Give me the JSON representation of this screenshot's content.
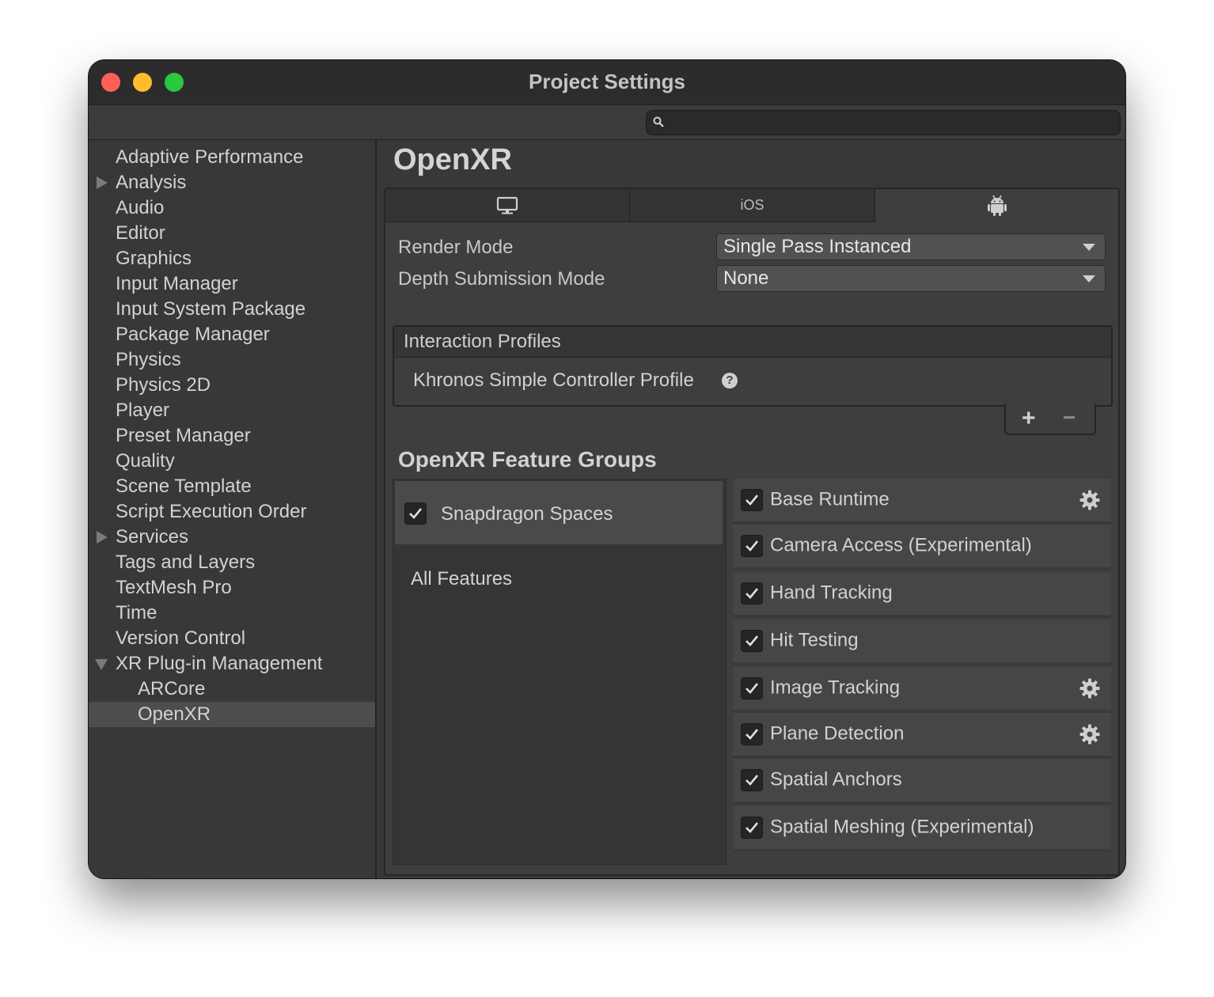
{
  "window": {
    "title": "Project Settings",
    "search": {
      "value": "",
      "placeholder": ""
    }
  },
  "sidebar": {
    "items": [
      {
        "label": "Adaptive Performance"
      },
      {
        "label": "Analysis",
        "expander": "collapsed"
      },
      {
        "label": "Audio"
      },
      {
        "label": "Editor"
      },
      {
        "label": "Graphics"
      },
      {
        "label": "Input Manager"
      },
      {
        "label": "Input System Package"
      },
      {
        "label": "Package Manager"
      },
      {
        "label": "Physics"
      },
      {
        "label": "Physics 2D"
      },
      {
        "label": "Player"
      },
      {
        "label": "Preset Manager"
      },
      {
        "label": "Quality"
      },
      {
        "label": "Scene Template"
      },
      {
        "label": "Script Execution Order"
      },
      {
        "label": "Services",
        "expander": "collapsed"
      },
      {
        "label": "Tags and Layers"
      },
      {
        "label": "TextMesh Pro"
      },
      {
        "label": "Time"
      },
      {
        "label": "Version Control"
      },
      {
        "label": "XR Plug-in Management",
        "expander": "expanded"
      },
      {
        "label": "ARCore",
        "child": true
      },
      {
        "label": "OpenXR",
        "child": true,
        "selected": true
      }
    ]
  },
  "main": {
    "heading": "OpenXR",
    "tabs": [
      {
        "icon": "desktop-icon",
        "label": ""
      },
      {
        "icon": "",
        "label": "iOS"
      },
      {
        "icon": "android-icon",
        "label": "",
        "active": true
      }
    ],
    "render_mode": {
      "label": "Render Mode",
      "value": "Single Pass Instanced"
    },
    "depth_mode": {
      "label": "Depth Submission Mode",
      "value": "None"
    },
    "interaction_profiles": {
      "header": "Interaction Profiles",
      "items": [
        "Khronos Simple Controller Profile"
      ],
      "help_glyph": "?",
      "add_glyph": "+",
      "remove_glyph": "−"
    },
    "feature_groups": {
      "title": "OpenXR Feature Groups",
      "groups": [
        {
          "label": "Snapdragon Spaces",
          "checked": true,
          "selected": true
        },
        {
          "label": "All Features"
        }
      ],
      "features": [
        {
          "label": "Base Runtime",
          "checked": true,
          "settings": true
        },
        {
          "label": "Camera Access (Experimental)",
          "checked": true,
          "settings": false
        },
        {
          "label": "Hand Tracking",
          "checked": true,
          "settings": false
        },
        {
          "label": "Hit Testing",
          "checked": true,
          "settings": false
        },
        {
          "label": "Image Tracking",
          "checked": true,
          "settings": true
        },
        {
          "label": "Plane Detection",
          "checked": true,
          "settings": true
        },
        {
          "label": "Spatial Anchors",
          "checked": true,
          "settings": false
        },
        {
          "label": "Spatial Meshing (Experimental)",
          "checked": true,
          "settings": false
        }
      ]
    }
  },
  "colors": {
    "background": "#383838",
    "titlebar": "#2c2c2c",
    "text": "#d2d2d2",
    "selected": "#4d4d4d"
  }
}
